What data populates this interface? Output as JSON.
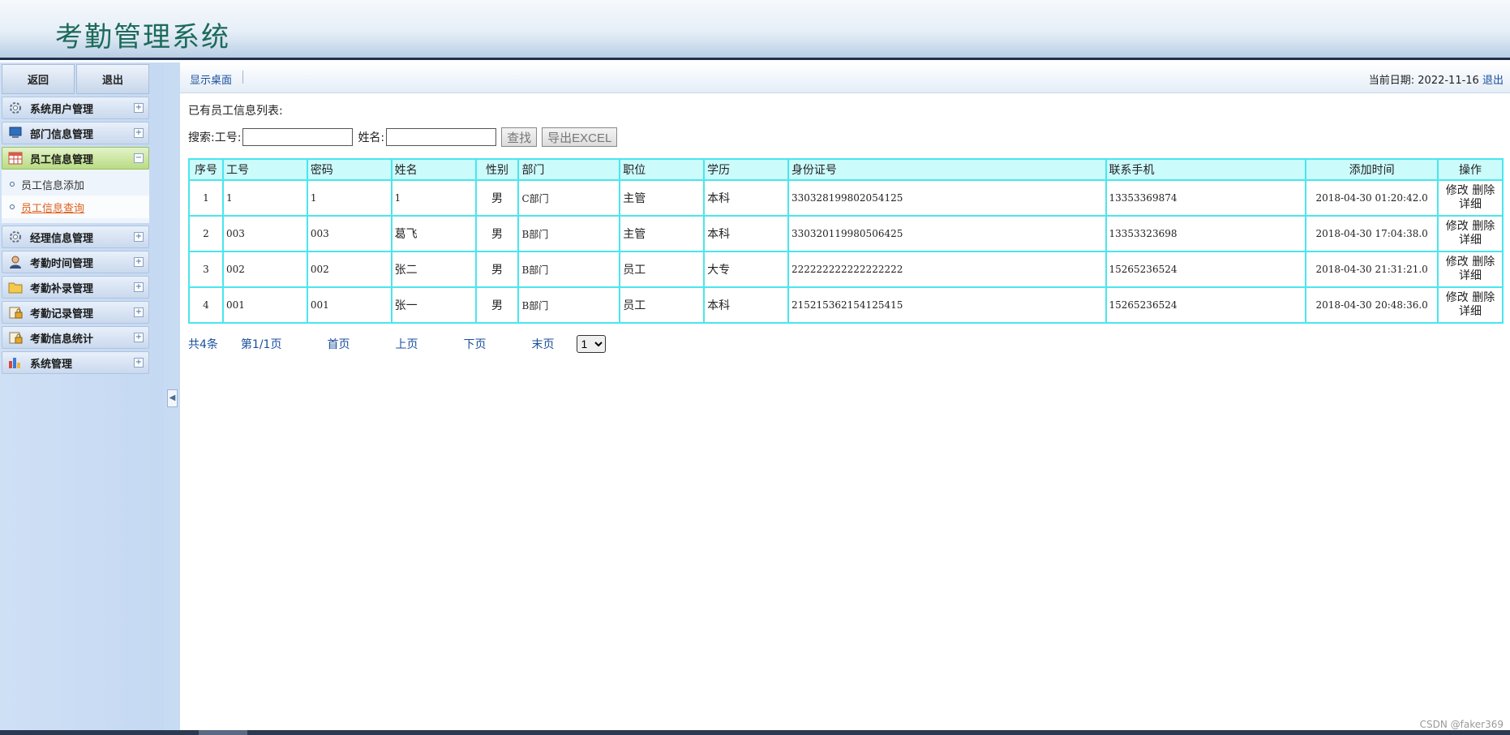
{
  "header": {
    "title": "考勤管理系统"
  },
  "sidebar": {
    "back_label": "返回",
    "logout_label": "退出",
    "menus": [
      {
        "label": "系统用户管理",
        "icon": "gear-icon",
        "toggle": "+"
      },
      {
        "label": "部门信息管理",
        "icon": "monitor-icon",
        "toggle": "+"
      },
      {
        "label": "员工信息管理",
        "icon": "table-icon",
        "toggle": "−"
      },
      {
        "label": "经理信息管理",
        "icon": "gear-icon",
        "toggle": "+"
      },
      {
        "label": "考勤时间管理",
        "icon": "user-icon",
        "toggle": "+"
      },
      {
        "label": "考勤补录管理",
        "icon": "folder-icon",
        "toggle": "+"
      },
      {
        "label": "考勤记录管理",
        "icon": "lock-icon",
        "toggle": "+"
      },
      {
        "label": "考勤信息统计",
        "icon": "lock-icon",
        "toggle": "+"
      },
      {
        "label": "系统管理",
        "icon": "chart-icon",
        "toggle": "+"
      }
    ],
    "submenu": [
      {
        "label": "员工信息添加"
      },
      {
        "label": "员工信息查询"
      }
    ],
    "collapse_glyph": "◀"
  },
  "toolbar": {
    "desktop_link": "显示桌面",
    "date_label": "当前日期: ",
    "date_value": "2022-11-16",
    "logout_link": "退出"
  },
  "main": {
    "list_title": "已有员工信息列表:",
    "search": {
      "label": "搜索: ",
      "emp_no_label": "工号:",
      "emp_no_value": "",
      "name_label": "姓名:",
      "name_value": "",
      "find_button": "查找",
      "export_button": "导出EXCEL"
    },
    "table": {
      "headers": [
        "序号",
        "工号",
        "密码",
        "姓名",
        "性别",
        "部门",
        "职位",
        "学历",
        "身份证号",
        "联系手机",
        "添加时间",
        "操作"
      ],
      "rows": [
        [
          "1",
          "1",
          "1",
          "1",
          "男",
          "C部门",
          "主管",
          "本科",
          "330328199802054125",
          "13353369874",
          "2018-04-30 01:20:42.0"
        ],
        [
          "2",
          "003",
          "003",
          "葛飞",
          "男",
          "B部门",
          "主管",
          "本科",
          "330320119980506425",
          "13353323698",
          "2018-04-30 17:04:38.0"
        ],
        [
          "3",
          "002",
          "002",
          "张二",
          "男",
          "B部门",
          "员工",
          "大专",
          "222222222222222222",
          "15265236524",
          "2018-04-30 21:31:21.0"
        ],
        [
          "4",
          "001",
          "001",
          "张一",
          "男",
          "B部门",
          "员工",
          "本科",
          "215215362154125415",
          "15265236524",
          "2018-04-30 20:48:36.0"
        ]
      ],
      "ops": {
        "edit": "修改",
        "delete": "删除",
        "detail": "详细"
      }
    },
    "pager": {
      "total": "共4条",
      "page_info": "第1/1页",
      "first": "首页",
      "prev": "上页",
      "next": "下页",
      "last": "末页",
      "select_value": "1"
    }
  },
  "watermark": "CSDN @faker369"
}
